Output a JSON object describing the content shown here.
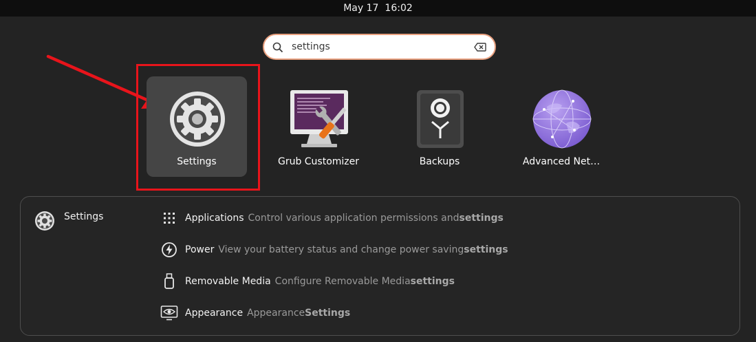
{
  "topbar": {
    "date": "May 17",
    "time": "16:02"
  },
  "search": {
    "value": "settings",
    "icons": [
      "search-icon",
      "clear-text-icon"
    ]
  },
  "apps": [
    {
      "label": "Settings",
      "icon": "settings-gear-icon",
      "selected": true
    },
    {
      "label": "Grub Customizer",
      "icon": "grub-customizer-icon"
    },
    {
      "label": "Backups",
      "icon": "backups-vault-icon"
    },
    {
      "label": "Advanced Net…",
      "icon": "advanced-network-globe-icon"
    }
  ],
  "results": {
    "source": {
      "name": "Settings",
      "icon": "settings-gear-icon"
    },
    "items": [
      {
        "title": "Applications",
        "desc": "Control various application permissions and ",
        "highlight": "settings",
        "icon": "grid-dots-icon"
      },
      {
        "title": "Power",
        "desc": "View your battery status and change power saving ",
        "highlight": "settings",
        "icon": "power-bolt-icon"
      },
      {
        "title": "Removable Media",
        "desc": "Configure Removable Media ",
        "highlight": "settings",
        "icon": "usb-drive-icon"
      },
      {
        "title": "Appearance",
        "desc": "Appearance ",
        "highlight": "Settings",
        "icon": "appearance-eye-icon"
      }
    ]
  },
  "colors": {
    "accent": "#e9a07f",
    "highlight_box": "#e8141b",
    "panel_border": "#4e4e4e"
  }
}
